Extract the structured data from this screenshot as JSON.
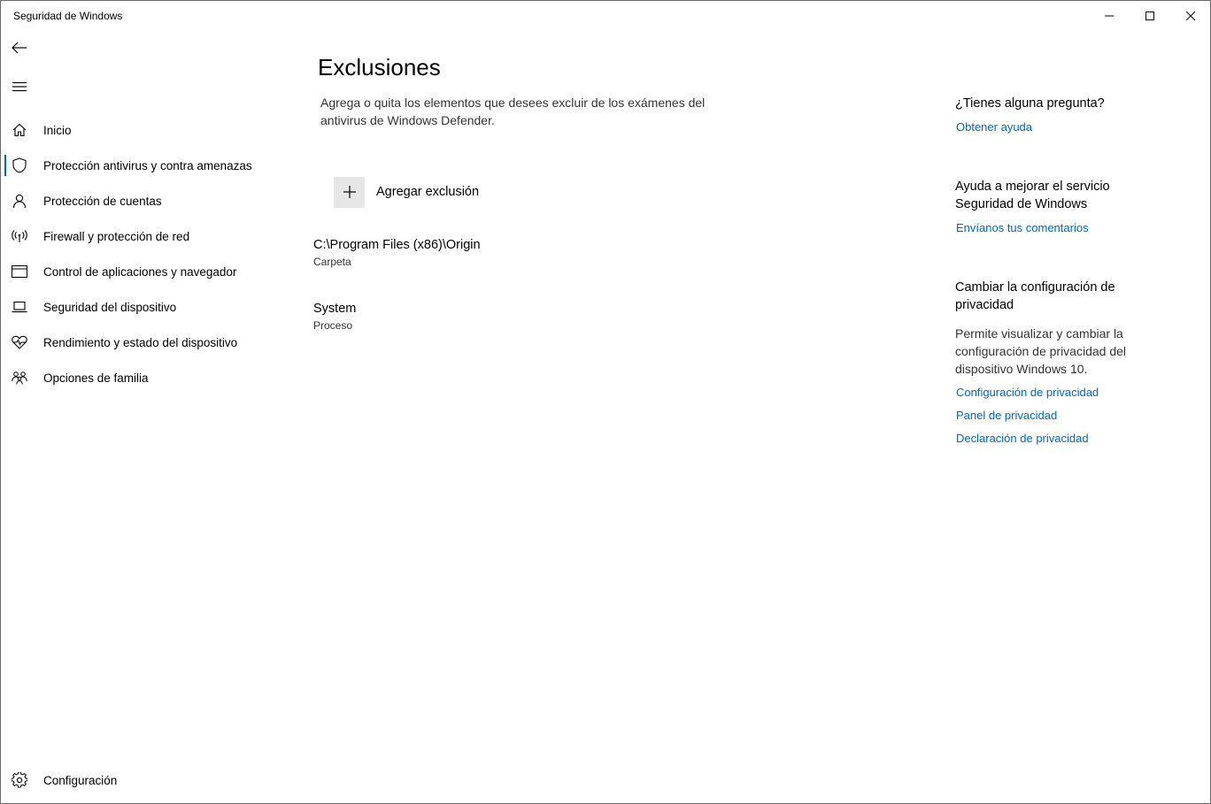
{
  "window": {
    "title": "Seguridad de Windows"
  },
  "titlebar": {
    "minimize_icon": "minimize-icon",
    "maximize_icon": "maximize-icon",
    "close_icon": "close-icon"
  },
  "sidebar": {
    "back_icon": "back-arrow-icon",
    "menu_icon": "hamburger-menu-icon",
    "items": [
      {
        "label": "Inicio",
        "icon": "home-icon",
        "active": false
      },
      {
        "label": "Protección antivirus y contra amenazas",
        "icon": "shield-icon",
        "active": true
      },
      {
        "label": "Protección de cuentas",
        "icon": "person-icon",
        "active": false
      },
      {
        "label": "Firewall y protección de red",
        "icon": "antenna-icon",
        "active": false
      },
      {
        "label": "Control de aplicaciones y navegador",
        "icon": "app-window-icon",
        "active": false
      },
      {
        "label": "Seguridad del dispositivo",
        "icon": "laptop-icon",
        "active": false
      },
      {
        "label": "Rendimiento y estado del dispositivo",
        "icon": "heart-pulse-icon",
        "active": false
      },
      {
        "label": "Opciones de familia",
        "icon": "family-icon",
        "active": false
      }
    ],
    "settings": {
      "label": "Configuración",
      "icon": "gear-icon"
    }
  },
  "main": {
    "title": "Exclusiones",
    "description": "Agrega o quita los elementos que desees excluir de los exámenes del antivirus de Windows Defender.",
    "add_button_label": "Agregar exclusión",
    "exclusions": [
      {
        "path": "C:\\Program Files (x86)\\Origin",
        "type": "Carpeta"
      },
      {
        "path": "System",
        "type": "Proceso"
      }
    ]
  },
  "side_panel": {
    "question_heading": "¿Tienes alguna pregunta?",
    "help_link": "Obtener ayuda",
    "improve_heading": "Ayuda a mejorar el servicio Seguridad de Windows",
    "feedback_link": "Envíanos tus comentarios",
    "privacy_heading": "Cambiar la configuración de privacidad",
    "privacy_text": "Permite visualizar y cambiar la configuración de privacidad del dispositivo Windows 10.",
    "privacy_links": [
      "Configuración de privacidad",
      "Panel de privacidad",
      "Declaración de privacidad"
    ]
  },
  "colors": {
    "accent": "#0067b8",
    "text": "#000000",
    "secondary_text": "#333333",
    "button_bg": "#e6e6e6"
  }
}
